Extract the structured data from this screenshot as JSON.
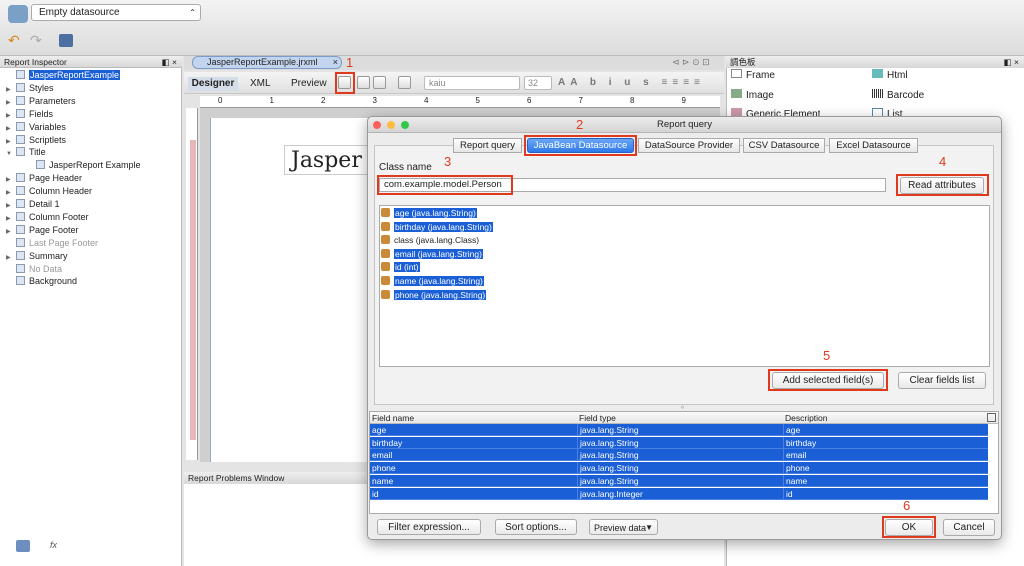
{
  "toolbar": {
    "datasource": "Empty datasource"
  },
  "inspector": {
    "title": "Report Inspector",
    "items": [
      {
        "label": "JasperReportExample",
        "selected": true
      },
      {
        "label": "Styles"
      },
      {
        "label": "Parameters"
      },
      {
        "label": "Fields"
      },
      {
        "label": "Variables"
      },
      {
        "label": "Scriptlets"
      },
      {
        "label": "Title"
      },
      {
        "label": "JasperReport Example"
      },
      {
        "label": "Page Header"
      },
      {
        "label": "Column Header"
      },
      {
        "label": "Detail 1"
      },
      {
        "label": "Column Footer"
      },
      {
        "label": "Page Footer"
      },
      {
        "label": "Last Page Footer",
        "dim": true
      },
      {
        "label": "Summary"
      },
      {
        "label": "No Data",
        "dim": true
      },
      {
        "label": "Background"
      }
    ]
  },
  "editor": {
    "file_tab": "JasperReportExample.jrxml",
    "tabs": [
      "Designer",
      "XML",
      "Preview"
    ],
    "font": "kaiu",
    "font_size": "32",
    "canvas_title": "Jasper",
    "ruler": [
      "0",
      "1",
      "2",
      "3",
      "4",
      "5",
      "6",
      "7",
      "8",
      "9"
    ]
  },
  "palette": {
    "title": "調色板",
    "items": [
      "Frame",
      "Html",
      "Image",
      "Barcode",
      "Generic Element",
      "List"
    ]
  },
  "problems": {
    "title": "Report Problems Window"
  },
  "dialog": {
    "title": "Report query",
    "tabs": [
      "Report query",
      "JavaBean Datasource",
      "DataSource Provider",
      "CSV Datasource",
      "Excel Datasource"
    ],
    "class_label": "Class name",
    "class_value": "com.example.model.Person",
    "read_button": "Read attributes",
    "attributes": [
      {
        "label": "age (java.lang.String)",
        "selected": true
      },
      {
        "label": "birthday (java.lang.String)",
        "selected": true
      },
      {
        "label": "class (java.lang.Class)",
        "selected": false
      },
      {
        "label": "email (java.lang.String)",
        "selected": true
      },
      {
        "label": "id (int)",
        "selected": true
      },
      {
        "label": "name (java.lang.String)",
        "selected": true
      },
      {
        "label": "phone (java.lang.String)",
        "selected": true
      }
    ],
    "add_button": "Add selected field(s)",
    "clear_button": "Clear fields list",
    "columns": [
      "Field name",
      "Field type",
      "Description"
    ],
    "fields": [
      [
        "age",
        "java.lang.String",
        "age"
      ],
      [
        "birthday",
        "java.lang.String",
        "birthday"
      ],
      [
        "email",
        "java.lang.String",
        "email"
      ],
      [
        "phone",
        "java.lang.String",
        "phone"
      ],
      [
        "name",
        "java.lang.String",
        "name"
      ],
      [
        "id",
        "java.lang.Integer",
        "id"
      ]
    ],
    "filter_button": "Filter expression...",
    "sort_button": "Sort options...",
    "preview_button": "Preview data",
    "ok_button": "OK",
    "cancel_button": "Cancel"
  },
  "annotations": [
    "1",
    "2",
    "3",
    "4",
    "5",
    "6"
  ],
  "colors": {
    "accent": "#1b5fd6",
    "annotation": "#e03a1e"
  }
}
